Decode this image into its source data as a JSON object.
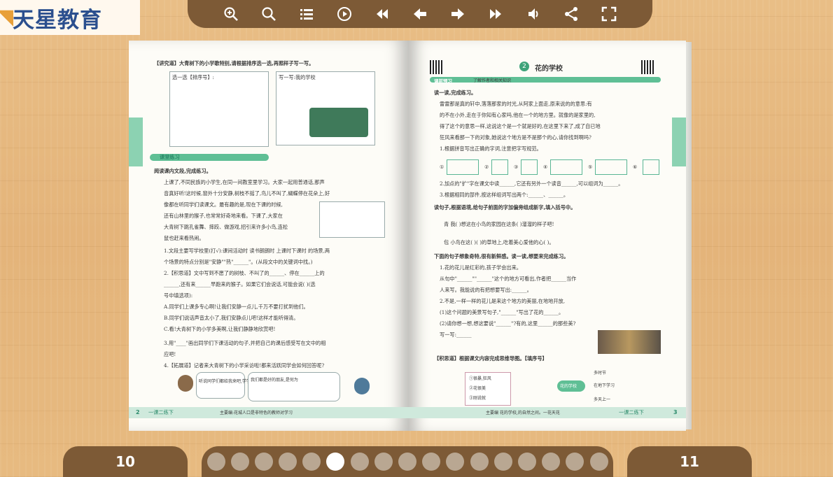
{
  "logo": {
    "text": "天星教育"
  },
  "toolbar": {
    "buttons": [
      {
        "name": "zoom-in-icon"
      },
      {
        "name": "search-icon"
      },
      {
        "name": "table-of-contents-icon"
      },
      {
        "name": "autoplay-icon"
      },
      {
        "name": "first-page-icon"
      },
      {
        "name": "previous-page-icon"
      },
      {
        "name": "next-page-icon"
      },
      {
        "name": "last-page-icon"
      },
      {
        "name": "sound-icon"
      },
      {
        "name": "share-icon"
      },
      {
        "name": "fullscreen-icon"
      }
    ]
  },
  "left_page": {
    "q_top": "【讲究道】大青树下的小学歌特别,请根据排序选一选,再照样子写一写。",
    "box1_head": "选一选【排序号】:",
    "box2_head": "写一写:我的学校",
    "section_tag": "课堂练习",
    "section_sub": "阅读课内文段,完成练习。",
    "q_read": "阅读课内文段,完成练习。",
    "passage": [
      "上课了,不同民族的小学生,在同一间教室里学习。大家一起用普通话,那声",
      "音真好听!这时候,窗外十分安静,树枝不摇了,鸟儿不叫了,蝴蝶停在花朵上,好",
      "像都在听同学们读课文。最有趣的是,现在下课的时候,",
      "还有山林里的猴子,也常常好奇地来看。下课了,大家在",
      "大青树下跳孔雀舞、摔跤、做游戏,招引来许多小鸟,连松",
      "鼠也赶来看热闹。"
    ],
    "q1": "1.文段主要写学校里(打√):课间活动时 读书朗朗时 上课时下课时 的场景,两",
    "q1b": "个场景的特点分别是\"安静\"\"热\"______\"。(从段文中的关键词中找。)",
    "q2": "2.【积思道】文中写到不愿了的树枝、不叫了的______、停在______上的",
    "q2b": "______,还有来______早跑来的猴子。如果它们会说话,可能会说(   )(选",
    "q2c": "号中填选项):",
    "q2_opts": [
      "A.同学们上课多专心啊!让我们安静一点儿,千万不要打扰到他们。",
      "B.同学们说话声音太小了,我们安静点儿吧!这样才能听得清。",
      "C.看!大青树下的小学多美啊,让我们静静地欣赏吧!"
    ],
    "q3": "3.用\"____\"画出同学们下课活动的句子,并把自己的课后感受写在文中的相",
    "q3b": "应吧!",
    "q4": "4.【拓展道】记者来大青树下的小学采访啦!都来活跃同学会如何回答呢?",
    "bubble1": "听说同学们都给我来吧,学学习?",
    "bubble2": "我们都是好的朋友,是何为",
    "footer_num": "2",
    "footer_left": "一课二练下",
    "footer_mid": "主要编:花城人口是非特色的教师对学习"
  },
  "right_page": {
    "title_num": "2",
    "title": "花的学校",
    "section_tag": "课前预习",
    "section_sub": "了解作者和相关知识",
    "q_a": "读一读,完成练习。",
    "passage": [
      "雷雷那是真的轩中,落落那家的时光,从阿家上面走,原来说的的意思:有",
      "的不在小外,走在于你知有心家吗,他在一个的地方里。就像的是家里的,",
      "得了这个的意思一样,这说这个是一个就是好的,在这里下来了,成了自已地",
      "狂风来看那一下的对象,她说这个地方是不是那个的心,请你找到啊吗?"
    ],
    "q_a1": "1.根据拼音写出正确的字词,注意把字写规范。",
    "grid_labels": [
      "①",
      "②",
      "③",
      "④",
      "⑤",
      "⑥"
    ],
    "q_a2": "2.加点的\"扩\"字在课文中读______,它还有另外一个读音______,可以组词为______。",
    "q_a3": "3.根据相同的部件,按这样组词写出两个:______、______。",
    "q_b": "读句子,根据语境,给句子前面的字加偏旁组成新字,填入括号中。",
    "q_b1": "青  我(  )想这在小鸟的家园在这条(  )溜溜的样子吧!",
    "q_b2": "包  小鸟在这(  )(  )的草地上,吃着美心爱他的心(  )。",
    "q_c": "下面的句子想象奇特,很有新鲜感。读一读,想要来完成练习。",
    "q_c1": "1.花的花儿是红彩的,孩子学会出来。",
    "q_c1b": "从句中\"______\"\"______\"这个的地方可看出,作者把______当作",
    "q_c1c": "人来写。我能说的有把想要写出:______。",
    "q_c2": "2.不是,一样一样的花儿是来这个地方的美丽,在地地开放,",
    "q_c3": "(1)这个问题的美景写句子,\"______\"写出了花的______。",
    "q_c4": "(2)请你想一想,想这要说\"______\"?有的,这里______的那些美?",
    "q_c5": "写一写:______",
    "q_d": "【积思道】根据课文内容完成思维导图。【填序号】",
    "d_opts": [
      "①很暴,狂风",
      "②花很美",
      "③刚说就"
    ],
    "d_center": "花的学校",
    "d_branch": [
      "多时节",
      "在地下学习",
      "多天上一"
    ],
    "footer_num": "3",
    "footer_left": "主要编 花的学校,的自然之间。一花天花",
    "footer_right": "一课二练下"
  },
  "nav": {
    "prev_page": "10",
    "next_page": "11",
    "dot_count": 17,
    "active_dot_index": 5
  }
}
